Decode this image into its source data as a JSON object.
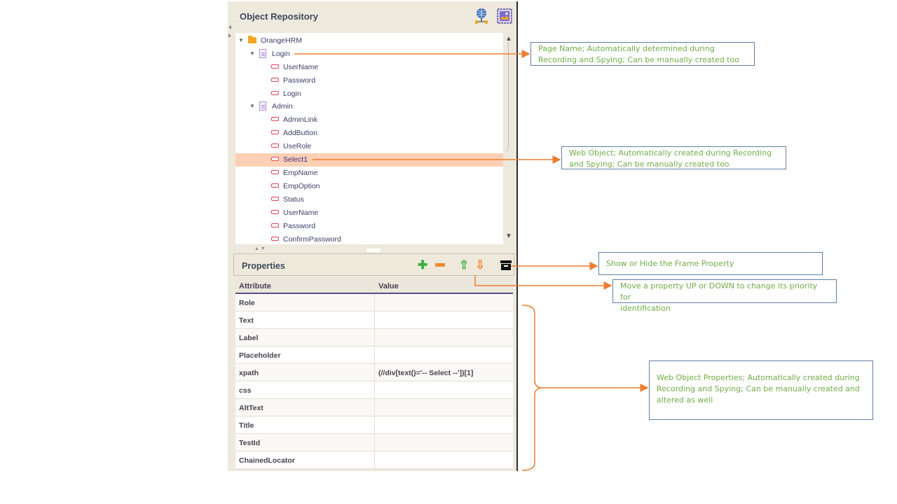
{
  "repository": {
    "title": "Object Repository",
    "icons": [
      "globe-network-icon",
      "frame-image-icon"
    ],
    "tree": [
      {
        "label": "OrangeHRM",
        "type": "project",
        "level": 0,
        "expanded": true
      },
      {
        "label": "Login",
        "type": "page",
        "level": 1,
        "expanded": true
      },
      {
        "label": "UserName",
        "type": "object",
        "level": 2
      },
      {
        "label": "Password",
        "type": "object",
        "level": 2
      },
      {
        "label": "Login",
        "type": "object",
        "level": 2
      },
      {
        "label": "Admin",
        "type": "page",
        "level": 1,
        "expanded": true
      },
      {
        "label": "AdminLink",
        "type": "object",
        "level": 2
      },
      {
        "label": "AddButton",
        "type": "object",
        "level": 2
      },
      {
        "label": "UseRole",
        "type": "object",
        "level": 2
      },
      {
        "label": "Select1",
        "type": "object",
        "level": 2,
        "selected": true
      },
      {
        "label": "EmpName",
        "type": "object",
        "level": 2
      },
      {
        "label": "EmpOption",
        "type": "object",
        "level": 2
      },
      {
        "label": "Status",
        "type": "object",
        "level": 2
      },
      {
        "label": "UserName",
        "type": "object",
        "level": 2
      },
      {
        "label": "Password",
        "type": "object",
        "level": 2
      },
      {
        "label": "ConfirmPassword",
        "type": "object",
        "level": 2
      }
    ]
  },
  "properties": {
    "title": "Properties",
    "toolbar": [
      "add-icon",
      "remove-icon",
      "move-up-icon",
      "move-down-icon",
      "frame-toggle-icon"
    ],
    "columns": {
      "attribute": "Attribute",
      "value": "Value"
    },
    "rows": [
      {
        "attribute": "Role",
        "value": ""
      },
      {
        "attribute": "Text",
        "value": ""
      },
      {
        "attribute": "Label",
        "value": ""
      },
      {
        "attribute": "Placeholder",
        "value": ""
      },
      {
        "attribute": "xpath",
        "value": "(//div[text()='-- Select --'])[1]"
      },
      {
        "attribute": "css",
        "value": ""
      },
      {
        "attribute": "AltText",
        "value": ""
      },
      {
        "attribute": "Title",
        "value": ""
      },
      {
        "attribute": "TestId",
        "value": ""
      },
      {
        "attribute": "ChainedLocator",
        "value": ""
      }
    ]
  },
  "callouts": {
    "page_name": [
      "Page Name;  Automatically determined during",
      "Recording and Spying; Can be manually created too"
    ],
    "web_object": [
      "Web Object;  Automatically created during Recording",
      "and Spying; Can be manually created too"
    ],
    "frame": [
      "Show or Hide the Frame Property"
    ],
    "move": [
      "Move a property UP or DOWN to change its priority for",
      "identification"
    ],
    "web_props": [
      "Web Object Properties; Automatically created during",
      "Recording and Spying; Can be manually created and",
      "altered as well"
    ]
  },
  "colors": {
    "accent": "#ed7d31",
    "callout_text": "#70ad47",
    "callout_border": "#5f7fa3",
    "selection": "#fbd0b4",
    "panel": "#eee9dd"
  }
}
